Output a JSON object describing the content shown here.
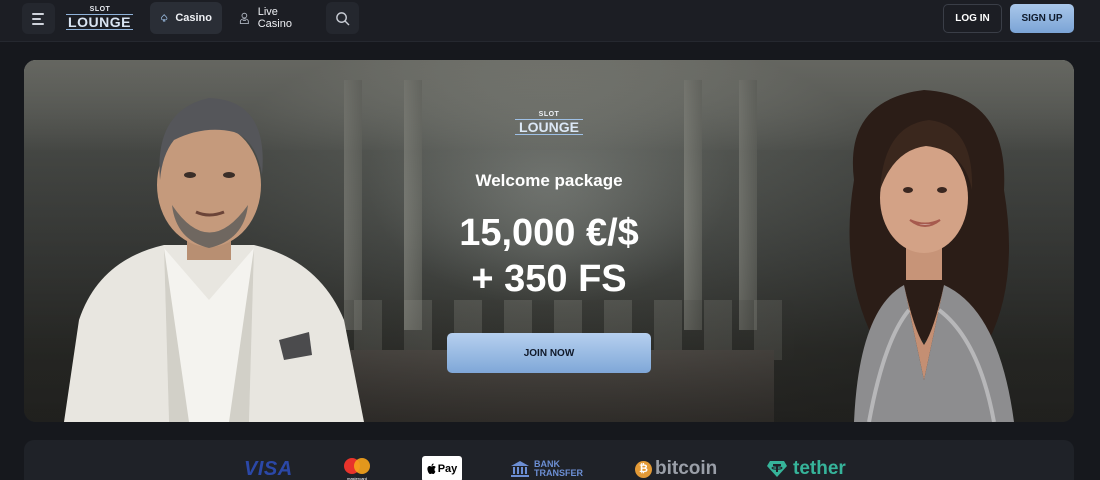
{
  "header": {
    "logo_top": "SLOT",
    "logo_main": "LOUNGE",
    "tabs": [
      {
        "label": "Casino",
        "icon": "spade-icon"
      },
      {
        "label": "Live Casino",
        "icon": "dealer-icon"
      }
    ],
    "login_label": "LOG IN",
    "signup_label": "SIGN UP"
  },
  "hero": {
    "logo_top": "SLOT",
    "logo_main": "LOUNGE",
    "welcome": "Welcome package",
    "amount": "15,000 €/$",
    "free_spins": "+ 350 FS",
    "cta_label": "JOIN NOW"
  },
  "payments": {
    "visa": "VISA",
    "mastercard_label": "mastercard",
    "applepay": "Pay",
    "bank_line1": "BANK",
    "bank_line2": "TRANSFER",
    "bitcoin": "bitcoin",
    "tether": "tether"
  },
  "colors": {
    "background": "#16181d",
    "header": "#1c1e24",
    "accent": "#8fb2e0",
    "visa": "#2b48a8",
    "tether": "#36b49a",
    "bitcoin": "#e39a36"
  }
}
